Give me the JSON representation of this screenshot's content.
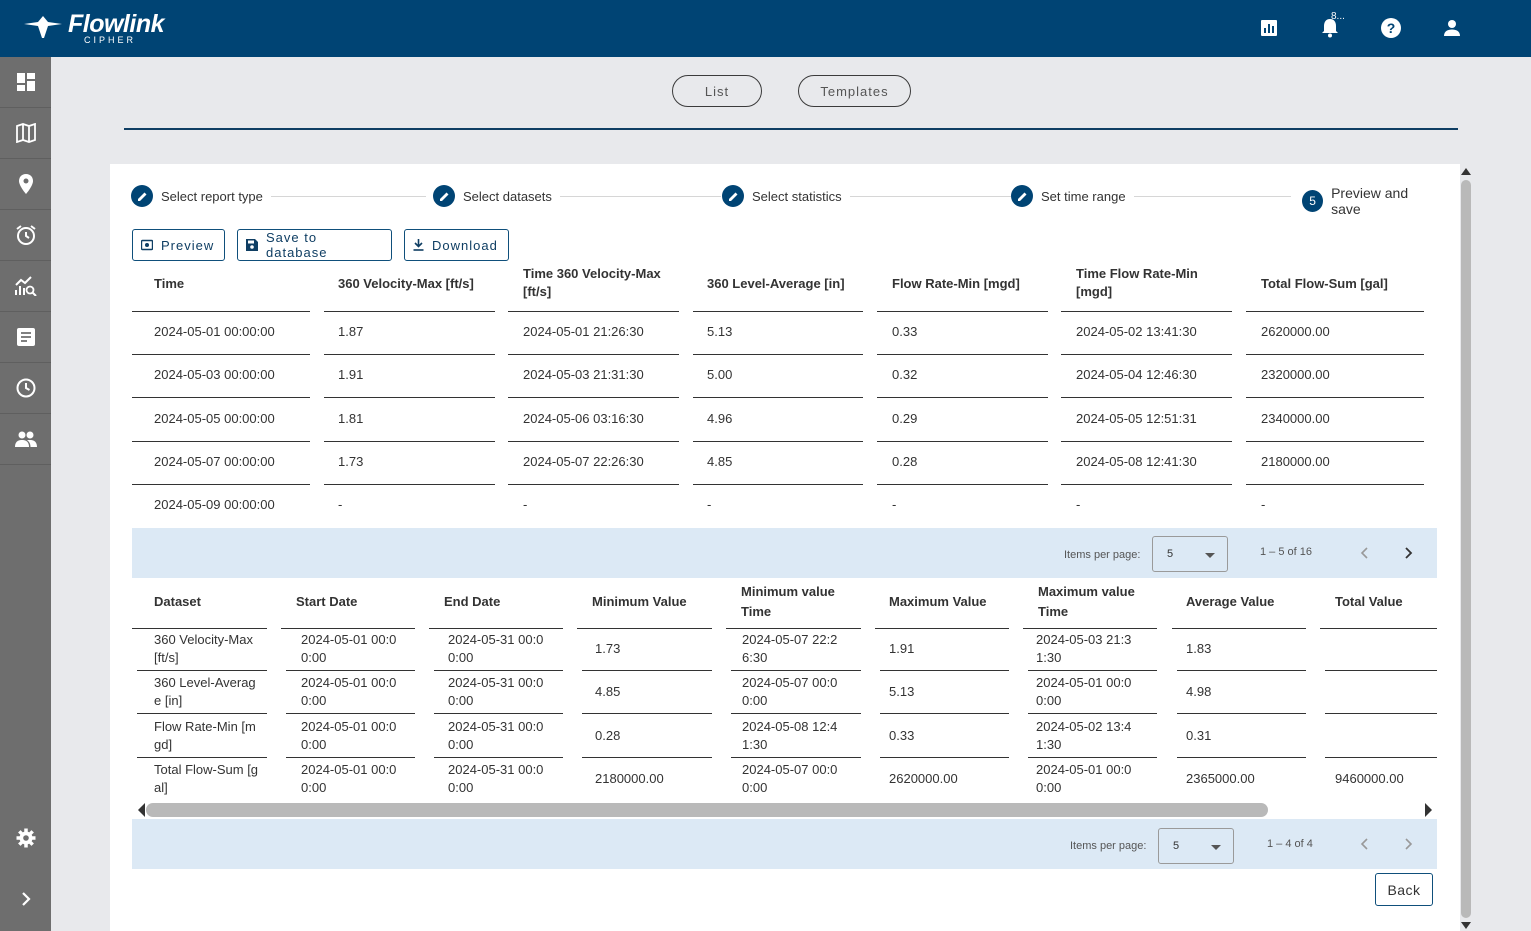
{
  "brand": {
    "name": "Flowlink",
    "sub": "CIPHER"
  },
  "header": {
    "notification_count": "8..."
  },
  "tabs": [
    {
      "label": "List"
    },
    {
      "label": "Templates"
    }
  ],
  "steps": [
    {
      "label": "Select report type",
      "marker": "edit"
    },
    {
      "label": "Select datasets",
      "marker": "edit"
    },
    {
      "label": "Select statistics",
      "marker": "edit"
    },
    {
      "label": "Set time range",
      "marker": "edit"
    },
    {
      "label": "Preview and save",
      "marker": "5"
    }
  ],
  "actions": {
    "preview": "Preview",
    "save": "Save to database",
    "download": "Download"
  },
  "results_table": {
    "columns": [
      [
        "Time"
      ],
      [
        "360 Velocity-Max [ft/s]"
      ],
      [
        "Time 360 Velocity-Max",
        "[ft/s]"
      ],
      [
        "360 Level-Average [in]"
      ],
      [
        "Flow Rate-Min [mgd]"
      ],
      [
        "Time Flow Rate-Min",
        "[mgd]"
      ],
      [
        "Total Flow-Sum [gal]"
      ]
    ],
    "rows": [
      [
        "2024-05-01 00:00:00",
        "1.87",
        "2024-05-01 21:26:30",
        "5.13",
        "0.33",
        "2024-05-02 13:41:30",
        "2620000.00"
      ],
      [
        "2024-05-03 00:00:00",
        "1.91",
        "2024-05-03 21:31:30",
        "5.00",
        "0.32",
        "2024-05-04 12:46:30",
        "2320000.00"
      ],
      [
        "2024-05-05 00:00:00",
        "1.81",
        "2024-05-06 03:16:30",
        "4.96",
        "0.29",
        "2024-05-05 12:51:31",
        "2340000.00"
      ],
      [
        "2024-05-07 00:00:00",
        "1.73",
        "2024-05-07 22:26:30",
        "4.85",
        "0.28",
        "2024-05-08 12:41:30",
        "2180000.00"
      ],
      [
        "2024-05-09 00:00:00",
        "-",
        "-",
        "-",
        "-",
        "-",
        "-"
      ]
    ]
  },
  "results_pager": {
    "items_per_page_label": "Items per page:",
    "items_per_page": "5",
    "range": "1 – 5 of 16"
  },
  "summary_table": {
    "columns": [
      [
        "Dataset"
      ],
      [
        "Start Date"
      ],
      [
        "End Date"
      ],
      [
        "Minimum Value"
      ],
      [
        "Minimum value",
        "Time"
      ],
      [
        "Maximum Value"
      ],
      [
        "Maximum value",
        "Time"
      ],
      [
        "Average Value"
      ],
      [
        "Total Value"
      ]
    ],
    "rows": [
      [
        [
          "360 Velocity-Max",
          "[ft/s]"
        ],
        [
          "2024-05-01 00:0",
          "0:00"
        ],
        [
          "2024-05-31 00:0",
          "0:00"
        ],
        [
          "1.73"
        ],
        [
          "2024-05-07 22:2",
          "6:30"
        ],
        [
          "1.91"
        ],
        [
          "2024-05-03 21:3",
          "1:30"
        ],
        [
          "1.83"
        ],
        [
          ""
        ]
      ],
      [
        [
          "360 Level-Averag",
          "e [in]"
        ],
        [
          "2024-05-01 00:0",
          "0:00"
        ],
        [
          "2024-05-31 00:0",
          "0:00"
        ],
        [
          "4.85"
        ],
        [
          "2024-05-07 00:0",
          "0:00"
        ],
        [
          "5.13"
        ],
        [
          "2024-05-01 00:0",
          "0:00"
        ],
        [
          "4.98"
        ],
        [
          ""
        ]
      ],
      [
        [
          "Flow Rate-Min [m",
          "gd]"
        ],
        [
          "2024-05-01 00:0",
          "0:00"
        ],
        [
          "2024-05-31 00:0",
          "0:00"
        ],
        [
          "0.28"
        ],
        [
          "2024-05-08 12:4",
          "1:30"
        ],
        [
          "0.33"
        ],
        [
          "2024-05-02 13:4",
          "1:30"
        ],
        [
          "0.31"
        ],
        [
          ""
        ]
      ],
      [
        [
          "Total Flow-Sum [g",
          "al]"
        ],
        [
          "2024-05-01 00:0",
          "0:00"
        ],
        [
          "2024-05-31 00:0",
          "0:00"
        ],
        [
          "2180000.00"
        ],
        [
          "2024-05-07 00:0",
          "0:00"
        ],
        [
          "2620000.00"
        ],
        [
          "2024-05-01 00:0",
          "0:00"
        ],
        [
          "2365000.00"
        ],
        [
          "9460000.00"
        ]
      ]
    ]
  },
  "summary_pager": {
    "items_per_page_label": "Items per page:",
    "items_per_page": "5",
    "range": "1 – 4 of 4"
  },
  "back_label": "Back",
  "colors": {
    "brand": "#004474",
    "sidebar": "#6e6e6e",
    "pager_bg": "#dce9f5",
    "page_bg": "#e8e9ec"
  }
}
